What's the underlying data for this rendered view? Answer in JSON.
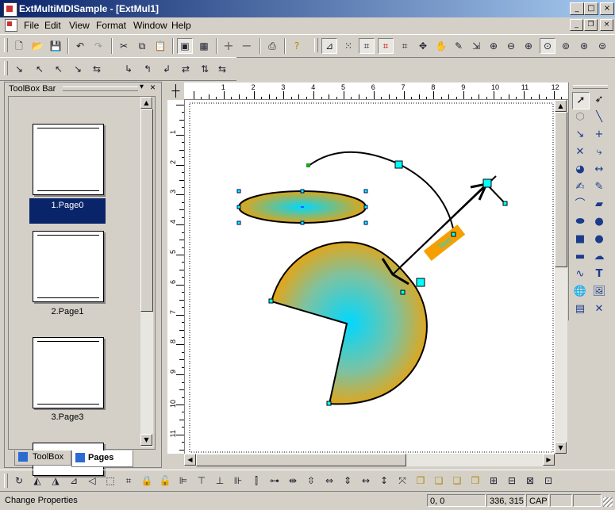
{
  "window": {
    "title": "ExtMultiMDISample - [ExtMul1]",
    "caption_buttons": [
      "_",
      "□",
      "×"
    ]
  },
  "menu": {
    "items": [
      "File",
      "Edit",
      "View",
      "Format",
      "Window",
      "Help"
    ]
  },
  "toolbar1": {
    "groups": [
      [
        "new-icon",
        "open-icon",
        "save-icon"
      ],
      [
        "undo-icon",
        "redo-icon"
      ],
      [
        "cut-icon",
        "copy-icon",
        "paste-icon"
      ],
      [
        "layout-icon",
        "table-icon"
      ],
      [
        "zoom-add-icon",
        "zoom-remove-icon"
      ],
      [
        "print-icon"
      ],
      [
        "help-icon"
      ]
    ]
  },
  "toolbar2": {
    "icons": [
      "align-tool-1",
      "align-tool-2",
      "align-tool-3",
      "align-tool-4",
      "align-tool-5",
      "align-tool-6",
      "align-tool-7",
      "align-tool-8",
      "align-tool-9",
      "align-tool-10"
    ]
  },
  "left_panel": {
    "title": "ToolBox Bar",
    "pages": [
      {
        "label": "1.Page0",
        "selected": true
      },
      {
        "label": "2.Page1",
        "selected": false
      },
      {
        "label": "3.Page3",
        "selected": false
      }
    ],
    "tabs": [
      {
        "label": "ToolBox",
        "active": false
      },
      {
        "label": "Pages",
        "active": true
      }
    ]
  },
  "ruler": {
    "h_labels": [
      "1",
      "2",
      "3",
      "4",
      "5",
      "6",
      "7",
      "8",
      "9",
      "10",
      "11",
      "12"
    ],
    "v_labels": [
      "1",
      "2",
      "3",
      "4",
      "5",
      "6",
      "7",
      "8",
      "9",
      "10",
      "11"
    ]
  },
  "canvas": {
    "rotated_label": "Text"
  },
  "status": {
    "message": "Change Properties",
    "position": "0, 0",
    "size": "336, 315",
    "cap": "CAP"
  },
  "colors": {
    "titlebar_start": "#0a246a",
    "titlebar_end": "#a6caf0",
    "selection": "#0a246a",
    "shape_outer": "#f5a000",
    "shape_inner": "#00d8ff",
    "handle": "#00ffff"
  }
}
